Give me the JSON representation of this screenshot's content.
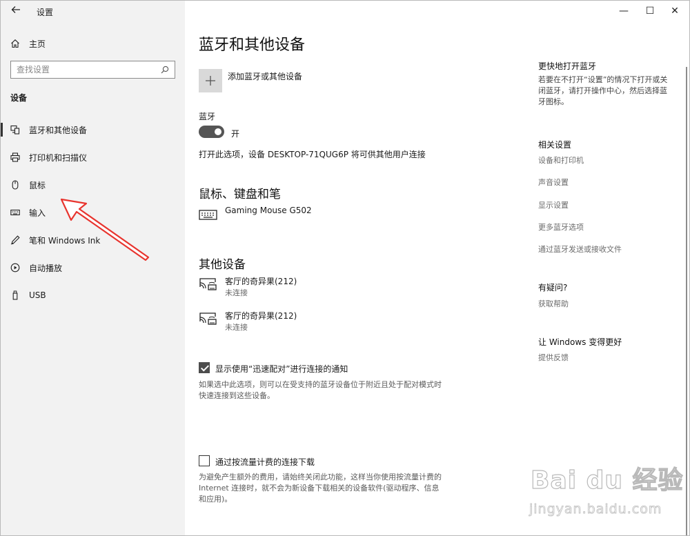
{
  "window": {
    "title": "设置",
    "controls": {
      "minimize": "—",
      "maximize": "☐",
      "close": "✕"
    }
  },
  "sidebar": {
    "home": "主页",
    "search_placeholder": "查找设置",
    "section": "设备",
    "items": [
      {
        "label": "蓝牙和其他设备",
        "icon": "bluetooth-devices-icon",
        "active": true
      },
      {
        "label": "打印机和扫描仪",
        "icon": "printer-icon",
        "active": false
      },
      {
        "label": "鼠标",
        "icon": "mouse-icon",
        "active": false
      },
      {
        "label": "输入",
        "icon": "keyboard-icon",
        "active": false
      },
      {
        "label": "笔和 Windows Ink",
        "icon": "pen-icon",
        "active": false
      },
      {
        "label": "自动播放",
        "icon": "autoplay-icon",
        "active": false
      },
      {
        "label": "USB",
        "icon": "usb-icon",
        "active": false
      }
    ]
  },
  "main": {
    "title": "蓝牙和其他设备",
    "add_device": "添加蓝牙或其他设备",
    "bluetooth": {
      "label": "蓝牙",
      "state": "开",
      "on": true,
      "discoverable_text": "打开此选项，设备 DESKTOP-71QUG6P 将可供其他用户连接"
    },
    "mouse_section": {
      "title": "鼠标、键盘和笔",
      "devices": [
        {
          "name": "Gaming Mouse G502"
        }
      ]
    },
    "other_section": {
      "title": "其他设备",
      "devices": [
        {
          "name": "客厅的奇异果(212)",
          "status": "未连接"
        },
        {
          "name": "客厅的奇异果(212)",
          "status": "未连接"
        }
      ]
    },
    "swift_pair": {
      "checked": true,
      "label": "显示使用“迅速配对”进行连接的通知",
      "desc_lines": [
        "如果选中此选项，则可以在受支持的蓝牙设备位于附近且处于配对模式时",
        "快速连接到这些设备。"
      ]
    },
    "metered": {
      "checked": false,
      "label": "通过按流量计费的连接下载",
      "desc_lines": [
        "为避免产生额外的费用，请始终关闭此功能，这样当你使用按流量计费的",
        "Internet 连接时，就不会为新设备下载相关的设备软件(驱动程序、信息",
        "和应用)。"
      ]
    }
  },
  "aside": {
    "faster": {
      "title": "更快地打开蓝牙",
      "lines": [
        "若要在不打开“设置”的情况下打开或关",
        "闭蓝牙，请打开操作中心，然后选择蓝",
        "牙图标。"
      ]
    },
    "related": {
      "title": "相关设置",
      "links": [
        "设备和打印机",
        "声音设置",
        "显示设置",
        "更多蓝牙选项",
        "通过蓝牙发送或接收文件"
      ]
    },
    "question": {
      "title": "有疑问?",
      "link": "获取帮助"
    },
    "improve": {
      "title": "让 Windows 变得更好",
      "link": "提供反馈"
    }
  },
  "watermark": {
    "brand": "Bai du 经验",
    "url": "jingyan.baidu.com"
  },
  "colors": {
    "sidebar_bg": "#f2f2f2",
    "toggle_on": "#555555",
    "annotation_arrow": "#e8342e"
  }
}
